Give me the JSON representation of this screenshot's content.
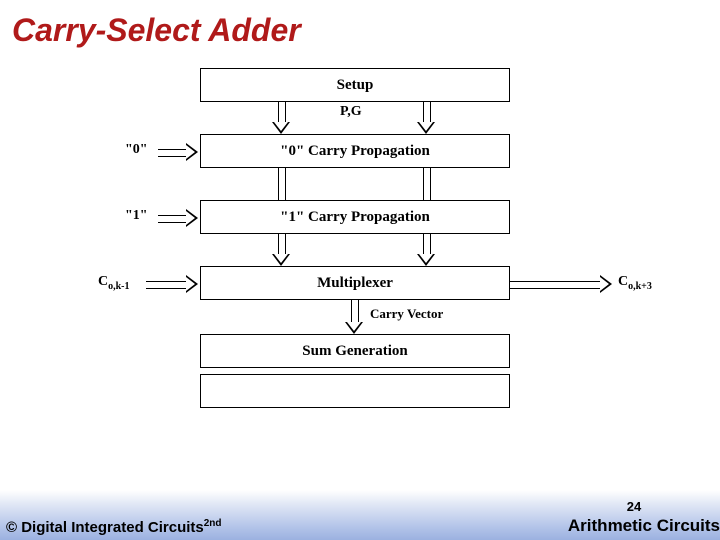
{
  "title": "Carry-Select Adder",
  "blocks": {
    "setup": "Setup",
    "carry0": "\"0\" Carry Propagation",
    "carry1": "\"1\" Carry Propagation",
    "mux": "Multiplexer",
    "sumgen": "Sum Generation"
  },
  "labels": {
    "pg": "P,G",
    "zero": "\"0\"",
    "one": "\"1\"",
    "cin": "C",
    "cin_sub": "o,k-1",
    "cout": "C",
    "cout_sub": "o,k+3",
    "carry_vector": "Carry Vector"
  },
  "footer": {
    "left_a": "© Digital Integrated Circuits",
    "left_ord": "2nd",
    "pagenum": "24",
    "chapter": "Arithmetic Circuits"
  }
}
